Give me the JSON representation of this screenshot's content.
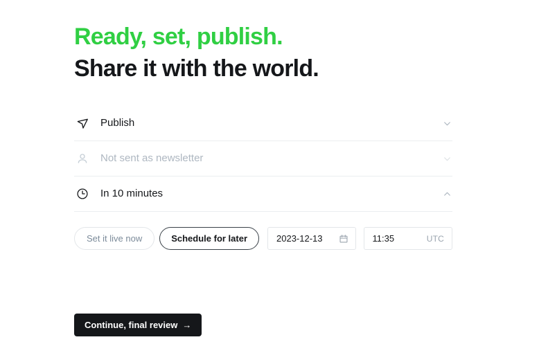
{
  "heading": {
    "line1": "Ready, set, publish.",
    "line2": "Share it with the world.",
    "line1_color": "#30cf43",
    "line2_color": "#15171a"
  },
  "options": [
    {
      "icon": "send-icon",
      "label": "Publish",
      "chevron": "chevron-down-icon",
      "state": "active"
    },
    {
      "icon": "user-icon",
      "label": "Not sent as newsletter",
      "chevron": "chevron-down-icon",
      "state": "muted"
    },
    {
      "icon": "clock-icon",
      "label": "In 10 minutes",
      "chevron": "chevron-up-icon",
      "state": "expanded"
    }
  ],
  "schedule": {
    "set_live_label": "Set it live now",
    "schedule_later_label": "Schedule for later",
    "selected": "Schedule for later",
    "date_value": "2023-12-13",
    "date_icon": "calendar-icon",
    "time_value": "11:35",
    "timezone": "UTC"
  },
  "cta": {
    "label": "Continue, final review",
    "arrow": "→",
    "background": "#15171a",
    "text_color": "#ffffff"
  }
}
